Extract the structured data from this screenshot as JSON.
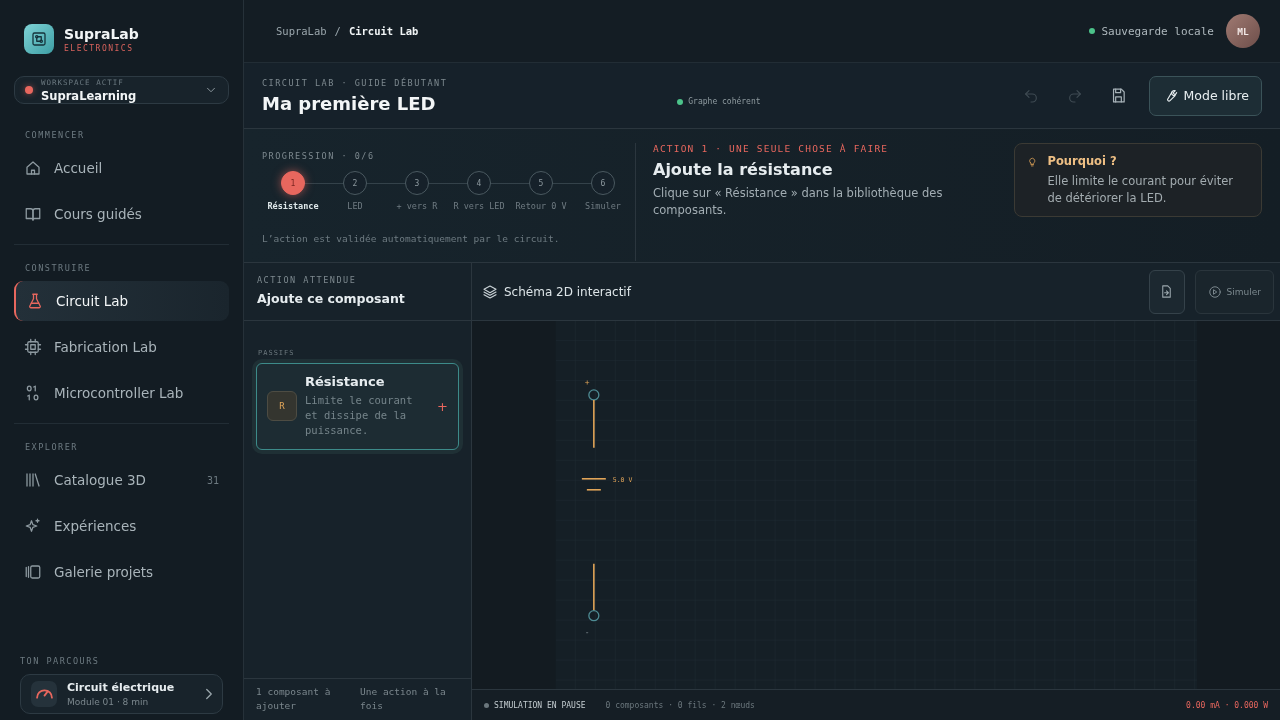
{
  "brand": {
    "name": "SupraLab",
    "tagline": "ELECTRONICS"
  },
  "workspace": {
    "label": "WORKSPACE ACTIF",
    "name": "SupraLearning"
  },
  "sidebar": {
    "sections": [
      {
        "label": "COMMENCER",
        "items": [
          {
            "label": "Accueil",
            "selected": false
          },
          {
            "label": "Cours guidés",
            "selected": false
          }
        ]
      },
      {
        "label": "CONSTRUIRE",
        "items": [
          {
            "label": "Circuit Lab",
            "selected": true
          },
          {
            "label": "Fabrication Lab",
            "selected": false
          },
          {
            "label": "Microcontroller Lab",
            "selected": false
          }
        ]
      },
      {
        "label": "EXPLORER",
        "items": [
          {
            "label": "Catalogue 3D",
            "selected": false,
            "count": "31"
          },
          {
            "label": "Expériences",
            "selected": false
          },
          {
            "label": "Galerie projets",
            "selected": false
          }
        ]
      }
    ],
    "journey": {
      "label": "TON PARCOURS",
      "title": "Circuit électrique",
      "subtitle": "Module 01 · 8 min"
    }
  },
  "breadcrumb": [
    "SupraLab",
    "/",
    "Circuit Lab"
  ],
  "save_status": "Sauvegarde locale",
  "avatar": "ML",
  "header": {
    "eyebrow": "CIRCUIT LAB · GUIDE DÉBUTANT",
    "title": "Ma première LED",
    "status": "Graphe cohérent",
    "undo_disabled": true,
    "redo_disabled": true,
    "mode_button": "Mode libre"
  },
  "guide": {
    "progress_label": "PROGRESSION · 0/6",
    "steps": [
      {
        "number": "1",
        "label": "Résistance",
        "selected": true
      },
      {
        "number": "2",
        "label": "LED",
        "selected": false
      },
      {
        "number": "3",
        "label": "+ vers R",
        "selected": false
      },
      {
        "number": "4",
        "label": "R vers LED",
        "selected": false
      },
      {
        "number": "5",
        "label": "Retour 0 V",
        "selected": false
      },
      {
        "number": "6",
        "label": "Simuler",
        "selected": false
      }
    ],
    "note": "L’action est validée automatiquement par le circuit.",
    "action_eyebrow": "ACTION 1 · UNE SEULE CHOSE À FAIRE",
    "action_title": "Ajoute la résistance",
    "action_text": "Clique sur « Résistance » dans la bibliothèque des composants.",
    "why_title": "Pourquoi ?",
    "why_text": "Elle limite le courant pour éviter de détériorer la LED."
  },
  "library": {
    "eyebrow": "ACTION ATTENDUE",
    "title": "Ajoute ce composant",
    "group": "PASSIFS",
    "components": [
      {
        "symbol": "R",
        "name": "Résistance",
        "description": "Limite le courant et dissipe de la puissance.",
        "add": "+"
      }
    ],
    "footer": [
      "1 composant à ajouter",
      "Une action à la fois"
    ]
  },
  "canvas": {
    "title": "Schéma 2D interactif",
    "simulate_button": "Simuler",
    "simulate_disabled": true,
    "plus_label": "+",
    "voltage_label": "5.0 V",
    "minus_label": "-"
  },
  "status_bar": {
    "state": "SIMULATION EN PAUSE",
    "counts": "0 composants · 0 fils · 2 nœuds",
    "readings": "0.00 mA · 0.000 W"
  }
}
